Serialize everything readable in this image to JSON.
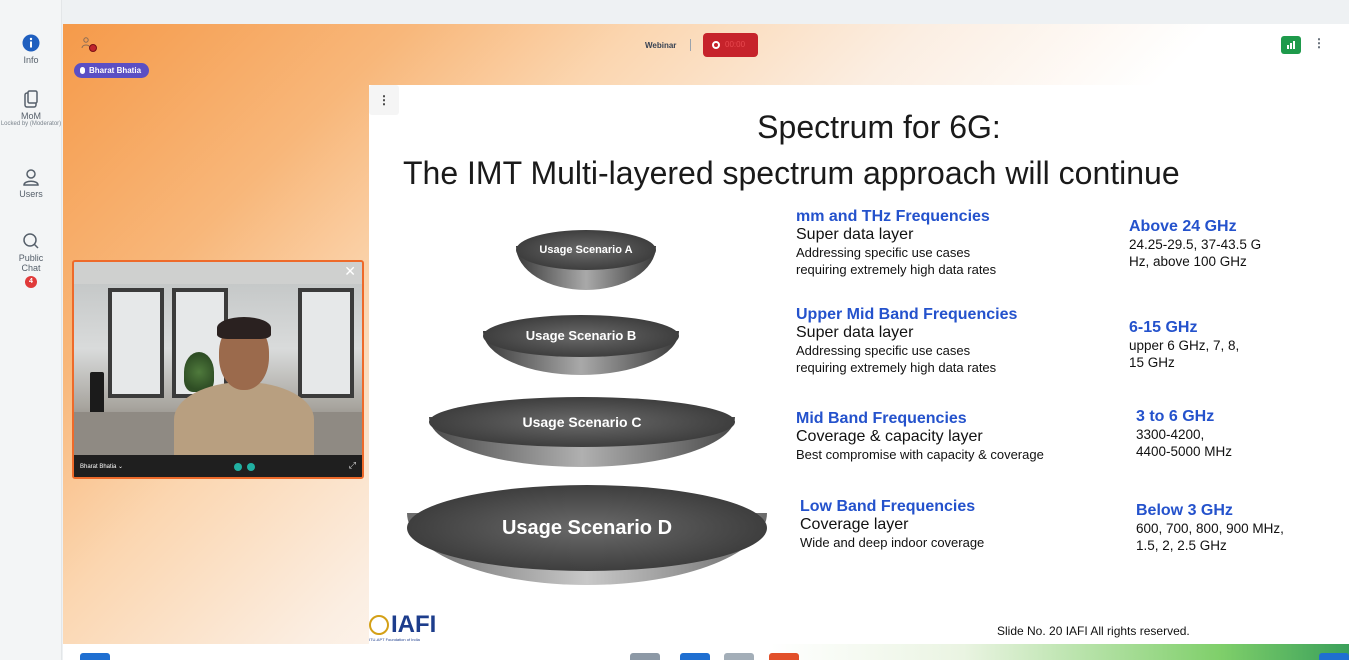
{
  "rail": {
    "info_label": "Info",
    "mom_label": "MoM",
    "mom_sub": "Locked by (Moderator)",
    "users_label": "Users",
    "chat_label": "Public Chat",
    "chat_badge": "4"
  },
  "topbar": {
    "presenter_name": "Bharat Bhatia",
    "meeting_type": "Webinar",
    "rec_label": "00:00"
  },
  "webcam": {
    "participant_name": "Bharat Bhatia ⌄"
  },
  "slide": {
    "title_line1": "Spectrum for 6G:",
    "title_line2": "The IMT Multi-layered spectrum  approach will continue",
    "scenarios": [
      "Usage Scenario A",
      "Usage Scenario B",
      "Usage Scenario C",
      "Usage Scenario D"
    ],
    "bands": [
      {
        "title": "mm and THz Frequencies",
        "layer": "Super data layer",
        "desc1": "Addressing specific use cases",
        "desc2": "requiring extremely high data rates"
      },
      {
        "title": "Upper Mid Band Frequencies",
        "layer": "Super data layer",
        "desc1": "Addressing specific use cases",
        "desc2": "requiring extremely high data rates"
      },
      {
        "title": "Mid Band Frequencies",
        "layer": "Coverage & capacity layer",
        "desc1": "Best compromise with capacity & coverage",
        "desc2": ""
      },
      {
        "title": "Low Band Frequencies",
        "layer": "Coverage layer",
        "desc1": "Wide and deep indoor coverage",
        "desc2": ""
      }
    ],
    "freqs": [
      {
        "title": "Above 24 GHz",
        "line1": "24.25-29.5, 37-43.5 G",
        "line2": "Hz, above 100 GHz"
      },
      {
        "title": "6-15 GHz",
        "line1": "upper 6 GHz, 7, 8,",
        "line2": "15 GHz"
      },
      {
        "title": "3 to 6 GHz",
        "line1": "3300-4200,",
        "line2": "4400-5000 MHz"
      },
      {
        "title": "Below 3 GHz",
        "line1": "600, 700, 800, 900 MHz,",
        "line2": "1.5, 2, 2.5 GHz"
      }
    ],
    "logo_text": "IAFI",
    "logo_subtext": "ITU-APT Foundation of India",
    "footer": "Slide No. 20  IAFI  All rights reserved."
  },
  "colors": {
    "accent_orange": "#ee6a2a",
    "record_red": "#c6232b",
    "presenter_purple": "#5b4fc4",
    "band_blue": "#2452cc",
    "signal_green": "#1e9a4b"
  }
}
